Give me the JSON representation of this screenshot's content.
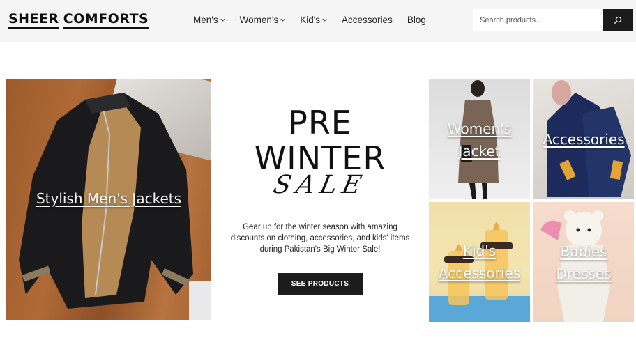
{
  "header": {
    "logo_word1": "SHEER",
    "logo_word2": "COMFORTS",
    "nav": [
      {
        "label": "Men's",
        "has_dropdown": true
      },
      {
        "label": "Women's",
        "has_dropdown": true
      },
      {
        "label": "Kid's",
        "has_dropdown": true
      },
      {
        "label": "Accessories",
        "has_dropdown": false
      },
      {
        "label": "Blog",
        "has_dropdown": false
      }
    ],
    "search_placeholder": "Search products...",
    "search_icon": "search-icon"
  },
  "hero": {
    "left_card_title": "Stylish Men's Jackets",
    "promo_line1": "PRE",
    "promo_line2": "WINTER",
    "promo_line3": "SALE",
    "promo_text": "Gear up for the winter season with amazing discounts on clothing, accessories, and kids' items during Pakistan's Big Winter Sale!",
    "cta_label": "SEE PRODUCTS"
  },
  "tiles": [
    {
      "title": "Women's Jacket"
    },
    {
      "title": "Accessories"
    },
    {
      "title": "Kid's Accessories"
    },
    {
      "title": "Babies Dresses"
    }
  ],
  "colors": {
    "header_bg": "#f5f5f5",
    "button_dark": "#1c1c1c",
    "text": "#111111"
  }
}
